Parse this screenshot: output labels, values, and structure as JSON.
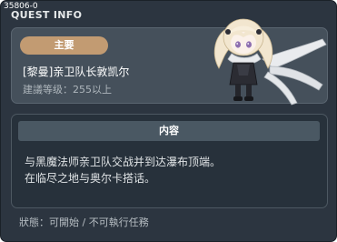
{
  "window": {
    "quest_id": "35806-0",
    "title": "QUEST INFO"
  },
  "header": {
    "category": "主要",
    "quest_name": "[黎曼]亲卫队长敦凯尔",
    "level_requirement": "建議等级：255以上"
  },
  "portrait": {
    "icon": "npc-portrait-icon",
    "hair_color": "#f2e6cf",
    "scarf_color": "#e9ebee",
    "eye_color": "#8e6fb0"
  },
  "content": {
    "header": "内容",
    "lines": [
      "与黑魔法师亲卫队交战并到达瀑布顶端。",
      "在临尽之地与奥尔卡搭话。"
    ]
  },
  "status": {
    "label": "狀態：",
    "value": "可開始",
    "separator": " / ",
    "extra": "不可執行任務"
  },
  "colors": {
    "window_bg": "#2c3540",
    "header_panel_bg": "#45505b",
    "badge_bg": "#c29b72",
    "content_bg": "#27313b",
    "content_header_bg": "#4a5863"
  }
}
